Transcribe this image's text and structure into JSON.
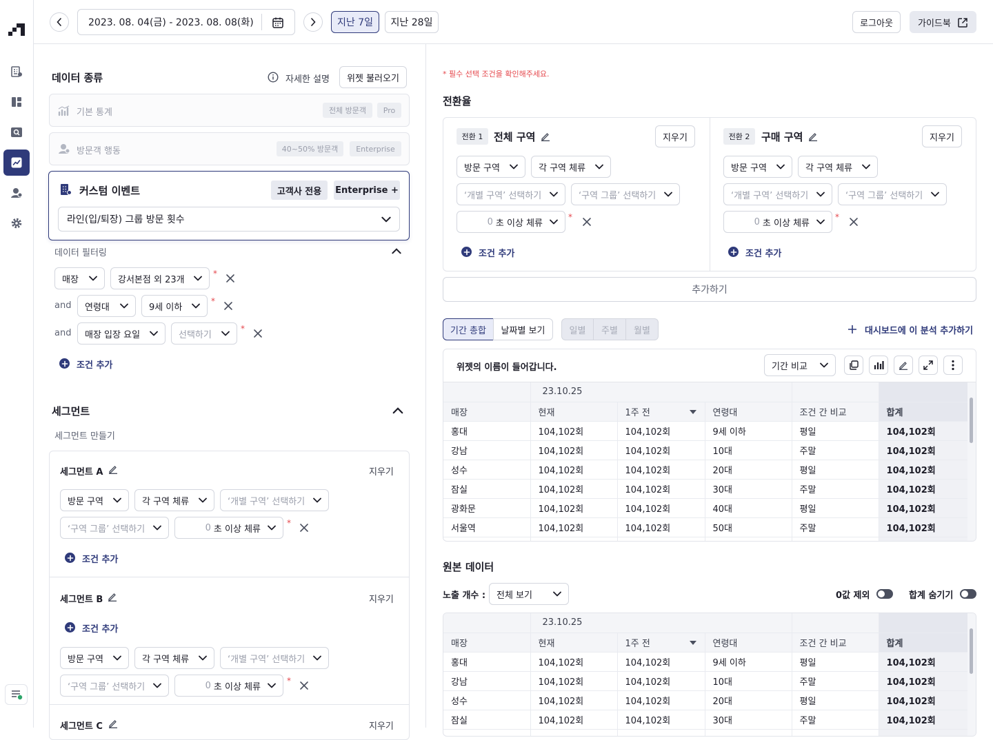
{
  "header": {
    "date_range": "2023. 08. 04(금) - 2023. 08. 08(화)",
    "last7": "지난 7일",
    "last28": "지난 28일",
    "logout": "로그아웃",
    "guidebook": "가이드북"
  },
  "left": {
    "data_type_title": "데이터 종류",
    "detail_label": "자세한 설명",
    "load_widget": "위젯 불러오기",
    "options": [
      {
        "label": "기본 통계",
        "badges": [
          "전체 방문객",
          "Pro"
        ]
      },
      {
        "label": "방문객 행동",
        "badges": [
          "40~50% 방문객",
          "Enterprise"
        ]
      }
    ],
    "custom_event": {
      "label": "커스텀 이벤트",
      "badge1": "고객사 전용",
      "badge2": "Enterprise +",
      "select_value": "라인(입/퇴장) 그룹 방문 횟수"
    },
    "filter_title": "데이터 필터링",
    "filters": {
      "row1": {
        "a": "매장",
        "b": "강서본점 외 23개"
      },
      "row2": {
        "conj": "and",
        "a": "연령대",
        "b": "9세 이하"
      },
      "row3": {
        "conj": "and",
        "a": "매장 입장 요일",
        "b": "선택하기"
      }
    },
    "add_condition": "조건 추가",
    "segment_title": "세그먼트",
    "segment_make": "세그먼트 만들기",
    "segment_a": "세그먼트 A",
    "segment_b": "세그먼트 B",
    "segment_c": "세그먼트 C",
    "clear": "지우기",
    "zone_visit": "방문 구역",
    "zone_stay": "각 구역 체류",
    "zone_individual": "‘개별 구역’ 선택하기",
    "zone_group": "‘구역 그룹’ 선택하기",
    "sec_num": "0",
    "sec_label": "초 이상 체류"
  },
  "right": {
    "notice_star": "*",
    "notice_red": "필수 선택 조건",
    "notice_rest": "을 확인해주세요.",
    "conversion_title": "전환율",
    "conv1_tag": "전환 1",
    "conv1_name": "전체 구역",
    "conv2_tag": "전환 2",
    "conv2_name": "구매 구역",
    "add_more": "추가하기",
    "tab_total": "기간 총합",
    "tab_daily_view": "날짜별 보기",
    "tab_day": "일별",
    "tab_week": "주별",
    "tab_month": "월별",
    "add_dashboard": "대시보드에 이 분석 추가하기",
    "widget_name": "위젯의 이름이 들어갑니다.",
    "compare_select": "기간 비교",
    "raw_title": "원본 데이터",
    "expose_label": "노출 개수 :",
    "expose_value": "전체 보기",
    "zero_exclude": "0값 제외",
    "hide_total": "합계 숨기기"
  },
  "table": {
    "date": "23.10.25",
    "headers": [
      "매장",
      "현재",
      "1주 전",
      "연령대",
      "조건 간 비교",
      "합계"
    ],
    "rows": [
      [
        "홍대",
        "104,102회",
        "104,102회",
        "9세 이하",
        "평일",
        "104,102회"
      ],
      [
        "강남",
        "104,102회",
        "104,102회",
        "10대",
        "주말",
        "104,102회"
      ],
      [
        "성수",
        "104,102회",
        "104,102회",
        "20대",
        "평일",
        "104,102회"
      ],
      [
        "잠실",
        "104,102회",
        "104,102회",
        "30대",
        "주말",
        "104,102회"
      ],
      [
        "광화문",
        "104,102회",
        "104,102회",
        "40대",
        "평일",
        "104,102회"
      ],
      [
        "서울역",
        "104,102회",
        "104,102회",
        "50대",
        "주말",
        "104,102회"
      ]
    ]
  }
}
